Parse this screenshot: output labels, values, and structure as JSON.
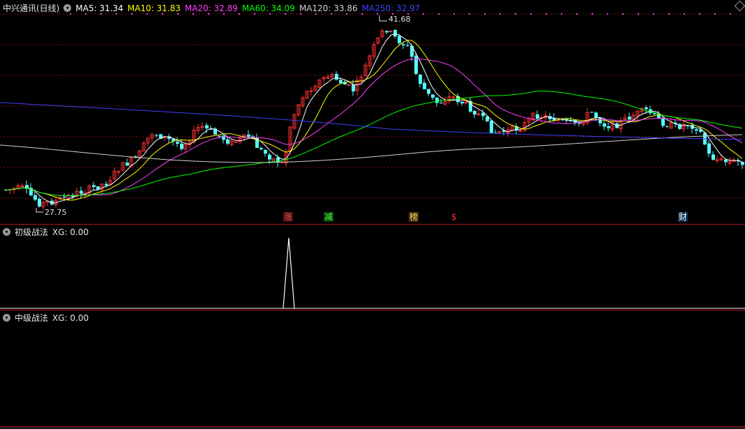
{
  "header": {
    "stock_name": "中兴通讯(日线)",
    "ma_legend": [
      {
        "label": "MA5: 31.34",
        "color": "#ffffff"
      },
      {
        "label": "MA10: 31.83",
        "color": "#ffff00"
      },
      {
        "label": "MA20: 32.89",
        "color": "#ff40ff"
      },
      {
        "label": "MA60: 34.09",
        "color": "#00ff00"
      },
      {
        "label": "MA120: 33.86",
        "color": "#d0d0d0"
      },
      {
        "label": "MA250: 32.97",
        "color": "#4040ff"
      }
    ]
  },
  "price_markers": {
    "high_label": "41.68",
    "low_label": "27.75"
  },
  "event_markers": [
    {
      "label": "涨",
      "color": "#ff5050",
      "bg": "#401010"
    },
    {
      "label": "减",
      "color": "#40ff40",
      "bg": "#104010"
    },
    {
      "label": "榜",
      "color": "#ffd060",
      "bg": "#403010"
    },
    {
      "label": "$",
      "color": "#ff3030",
      "bg": "#000000"
    },
    {
      "label": "财",
      "color": "#ffffff",
      "bg": "#103050"
    }
  ],
  "indicator1": {
    "title": "初级战法",
    "value_label": "XG: 0.00"
  },
  "indicator2": {
    "title": "中级战法",
    "value_label": "XG: 0.00"
  },
  "colors": {
    "up": "#ff3232",
    "down": "#54fcfc",
    "divider": "#b01020",
    "dots": "#ff40ff"
  }
}
